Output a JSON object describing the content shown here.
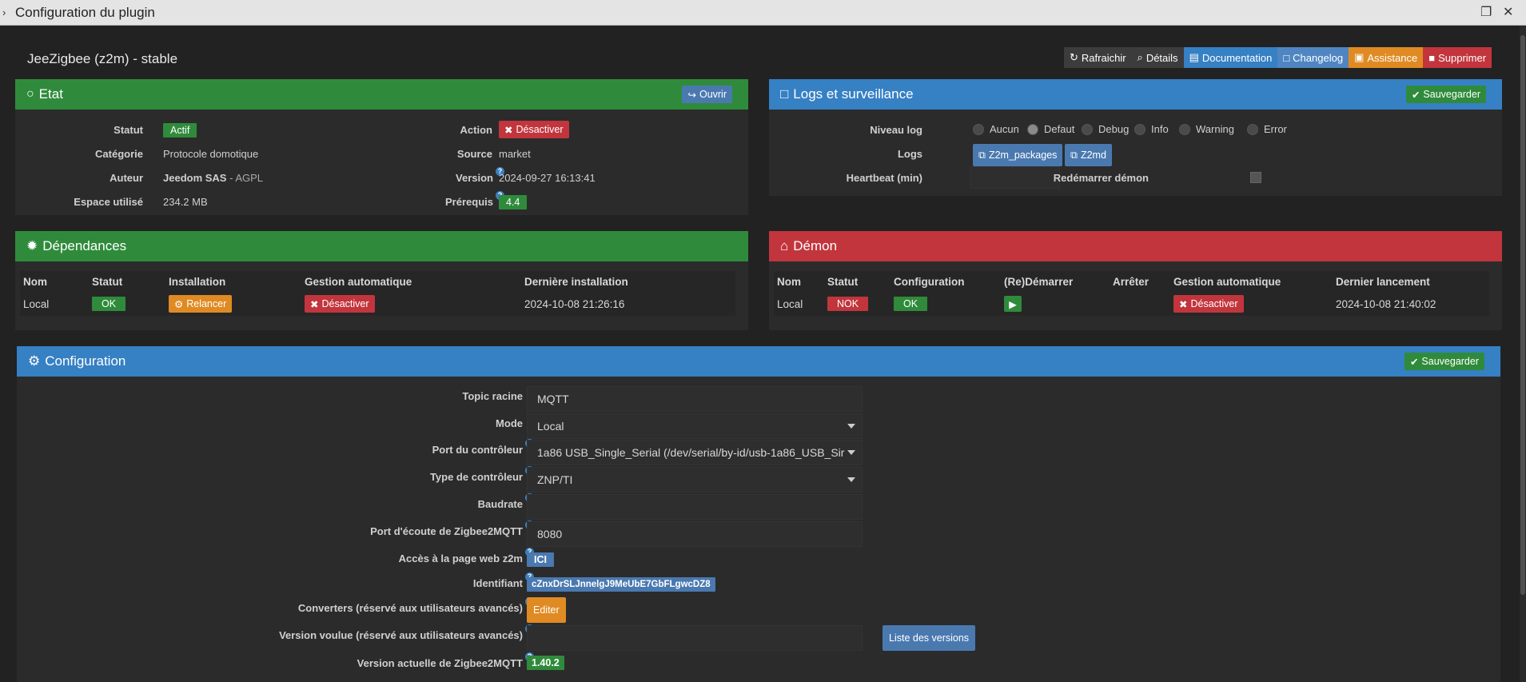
{
  "window": {
    "title": "Configuration du plugin"
  },
  "plugin": {
    "name": "JeeZigbee (z2m) - stable"
  },
  "toolbar": {
    "refresh": "Rafraichir",
    "details": "Détails",
    "documentation": "Documentation",
    "changelog": "Changelog",
    "assistance": "Assistance",
    "delete": "Supprimer"
  },
  "etat": {
    "title": "Etat",
    "open_btn": "Ouvrir",
    "statut_label": "Statut",
    "statut_value": "Actif",
    "categorie_label": "Catégorie",
    "categorie_value": "Protocole domotique",
    "auteur_label": "Auteur",
    "auteur_name": "Jeedom SAS",
    "auteur_license": " - AGPL",
    "espace_label": "Espace utilisé",
    "espace_value": "234.2 MB",
    "action_label": "Action",
    "action_btn": "Désactiver",
    "source_label": "Source",
    "source_value": "market",
    "version_label": "Version",
    "version_value": "2024-09-27 16:13:41",
    "prerequis_label": "Prérequis",
    "prerequis_value": "4.4"
  },
  "logs": {
    "title": "Logs et surveillance",
    "save_btn": "Sauvegarder",
    "niveau_label": "Niveau log",
    "levels": [
      "Aucun",
      "Defaut",
      "Debug",
      "Info",
      "Warning",
      "Error"
    ],
    "selected_level": "Defaut",
    "logs_label": "Logs",
    "log_btn1": "Z2m_packages",
    "log_btn2": "Z2md",
    "heartbeat_label": "Heartbeat (min)",
    "heartbeat_value": "",
    "restart_label": "Redémarrer démon"
  },
  "deps": {
    "title": "Dépendances",
    "headers": [
      "Nom",
      "Statut",
      "Installation",
      "Gestion automatique",
      "Dernière installation"
    ],
    "row": {
      "nom": "Local",
      "statut": "OK",
      "install_btn": "Relancer",
      "auto_btn": "Désactiver",
      "last": "2024-10-08 21:26:16"
    }
  },
  "demon": {
    "title": "Démon",
    "headers": [
      "Nom",
      "Statut",
      "Configuration",
      "(Re)Démarrer",
      "Arrêter",
      "Gestion automatique",
      "Dernier lancement"
    ],
    "row": {
      "nom": "Local",
      "statut": "NOK",
      "config": "OK",
      "auto_btn": "Désactiver",
      "last": "2024-10-08 21:40:02"
    }
  },
  "config": {
    "title": "Configuration",
    "save_btn": "Sauvegarder",
    "topic_label": "Topic racine",
    "topic_value": "MQTT",
    "mode_label": "Mode",
    "mode_value": "Local",
    "port_label": "Port du contrôleur",
    "port_value": "1a86 USB_Single_Serial (/dev/serial/by-id/usb-1a86_USB_Sir",
    "type_label": "Type de contrôleur",
    "type_value": "ZNP/TI",
    "baud_label": "Baudrate",
    "baud_value": "",
    "ecoute_label": "Port d'écoute de Zigbee2MQTT",
    "ecoute_value": "8080",
    "web_label": "Accès à la page web z2m",
    "web_btn": "ICI",
    "ident_label": "Identifiant",
    "ident_value": "cZnxDrSLJnnelgJ9MeUbE7GbFLgwcDZ8",
    "conv_label": "Converters (réservé aux utilisateurs avancés)",
    "conv_btn": "Editer",
    "vvoulue_label": "Version voulue (réservé aux utilisateurs avancés)",
    "vvoulue_value": "",
    "versions_btn": "Liste des versions",
    "vact_label": "Version actuelle de Zigbee2MQTT",
    "vact_value": "1.40.2"
  },
  "colors": {
    "green": "#2f8b3b",
    "blue": "#3680c4",
    "red": "#c2353d",
    "orange": "#e08a23"
  }
}
